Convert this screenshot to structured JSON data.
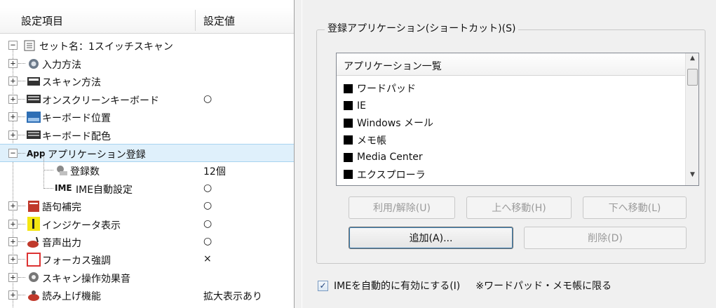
{
  "tree": {
    "header_item": "設定項目",
    "header_value": "設定値",
    "root": {
      "expander": "−",
      "label": "セット名：1スイッチスキャン"
    },
    "items": [
      {
        "expander": "+",
        "icon": "input-method-icon",
        "label": "入力方法",
        "value": ""
      },
      {
        "expander": "+",
        "icon": "scan-method-icon",
        "label": "スキャン方法",
        "value": ""
      },
      {
        "expander": "+",
        "icon": "keyboard-icon",
        "label": "オンスクリーンキーボード",
        "value": "○"
      },
      {
        "expander": "+",
        "icon": "keyboard-position-icon",
        "label": "キーボード位置",
        "value": ""
      },
      {
        "expander": "+",
        "icon": "keyboard-color-icon",
        "label": "キーボード配色",
        "value": ""
      },
      {
        "expander": "−",
        "icon": "app-icon",
        "label": "アプリケーション登録",
        "value": "",
        "selected": true,
        "icon_text": "App"
      },
      {
        "child": true,
        "icon": "registered-count-icon",
        "label": "登録数",
        "value": "12個"
      },
      {
        "child": true,
        "icon": "ime-icon",
        "label": "IME自動設定",
        "value": "○",
        "icon_text": "IME"
      },
      {
        "expander": "+",
        "icon": "word-completion-icon",
        "label": "語句補完",
        "value": "○"
      },
      {
        "expander": "+",
        "icon": "indicator-icon",
        "label": "インジケータ表示",
        "value": "○"
      },
      {
        "expander": "+",
        "icon": "speaker-icon",
        "label": "音声出力",
        "value": "○"
      },
      {
        "expander": "+",
        "icon": "focus-highlight-icon",
        "label": "フォーカス強調",
        "value": "×"
      },
      {
        "expander": "+",
        "icon": "scan-sound-icon",
        "label": "スキャン操作効果音",
        "value": ""
      },
      {
        "expander": "+",
        "icon": "read-aloud-icon",
        "label": "読み上げ機能",
        "value": "拡大表示あり"
      }
    ]
  },
  "apps": {
    "group_title": "登録アプリケーション(ショートカット)(S)",
    "list_header": "アプリケーション一覧",
    "list_items": [
      "ワードパッド",
      "IE",
      "Windows メール",
      "メモ帳",
      "Media Center",
      "エクスプローラ"
    ],
    "buttons": {
      "use_toggle": "利用/解除(U)",
      "move_up": "上へ移動(H)",
      "move_down": "下へ移動(L)",
      "add": "追加(A)...",
      "delete": "削除(D)"
    }
  },
  "ime": {
    "checkbox_label": "IMEを自動的に有効にする(I)",
    "checked": true,
    "note": "※ワードパッド・メモ帳に限る"
  },
  "colors": {
    "selection": "#dff0fb",
    "accent": "#3c7fb1"
  }
}
